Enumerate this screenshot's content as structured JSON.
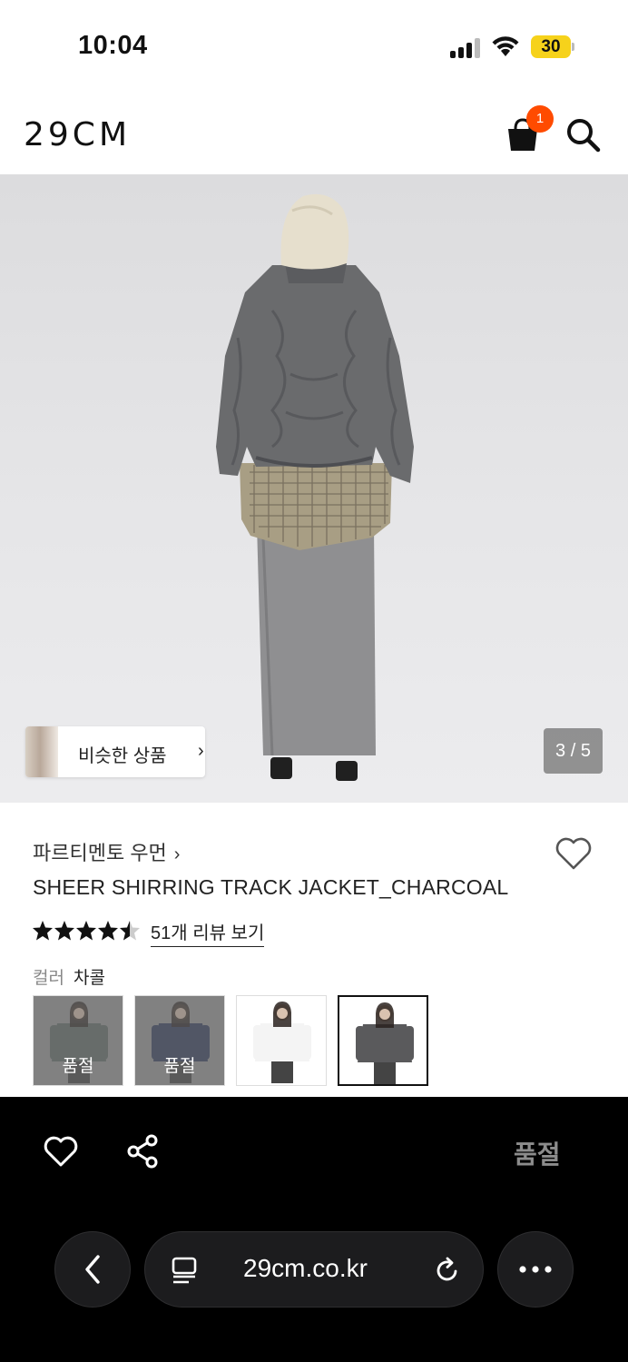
{
  "status_bar": {
    "time": "10:04",
    "battery": "30"
  },
  "header": {
    "logo": "29CM",
    "cart_badge": "1"
  },
  "gallery": {
    "similar_label": "비슷한 상품",
    "similar_arrow": "›",
    "page_indicator": "3 / 5"
  },
  "product": {
    "brand": "파르티멘토 우먼",
    "brand_arrow": "›",
    "name": "SHEER SHIRRING TRACK JACKET_CHARCOAL",
    "rating": 4.5,
    "review_link": "51개 리뷰 보기",
    "color_label": "컬러",
    "color_value": "차콜",
    "swatches": [
      {
        "label": "품절",
        "sold_out": true,
        "color": "#5f6a66"
      },
      {
        "label": "품절",
        "sold_out": true,
        "color": "#2f3a5c"
      },
      {
        "label": "",
        "sold_out": false,
        "color": "#f4f4f4"
      },
      {
        "label": "",
        "sold_out": false,
        "color": "#5a5a5c"
      }
    ]
  },
  "bottom_bar": {
    "soldout_cta": "품절"
  },
  "browser": {
    "url": "29cm.co.kr"
  },
  "colors": {
    "accent_badge": "#ff4b00",
    "battery": "#f6d21b",
    "bottom_bg": "#000000"
  }
}
